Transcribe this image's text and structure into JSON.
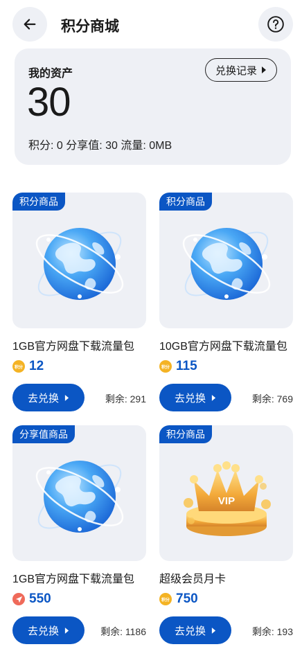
{
  "header": {
    "title": "积分商城",
    "back_icon": "arrow-left-icon",
    "help_icon": "question-circle-icon"
  },
  "assets": {
    "title": "我的资产",
    "value": "30",
    "detail": "积分: 0 分享值: 30 流量: 0MB",
    "history_label": "兑换记录"
  },
  "products": [
    {
      "tag": "积分商品",
      "name": "1GB官方网盘下载流量包",
      "currency_icon": "points-coin-icon",
      "currency_label": "积分",
      "price": "12",
      "button_label": "去兑换",
      "remaining": "剩余: 291",
      "image": "globe"
    },
    {
      "tag": "积分商品",
      "name": "10GB官方网盘下载流量包",
      "currency_icon": "points-coin-icon",
      "currency_label": "积分",
      "price": "115",
      "button_label": "去兑换",
      "remaining": "剩余: 769",
      "image": "globe"
    },
    {
      "tag": "分享值商品",
      "name": "1GB官方网盘下载流量包",
      "currency_icon": "share-plane-icon",
      "price": "550",
      "button_label": "去兑换",
      "remaining": "剩余: 1186",
      "image": "globe"
    },
    {
      "tag": "积分商品",
      "name": "超级会员月卡",
      "currency_icon": "points-coin-icon",
      "currency_label": "积分",
      "price": "750",
      "button_label": "去兑换",
      "remaining": "剩余: 193",
      "image": "vip-crown",
      "vip_text": "VIP"
    }
  ],
  "colors": {
    "accent": "#0b56c4",
    "card_bg": "#eef0f5",
    "coin": "#f4b324",
    "share": "#ef6a5a"
  }
}
